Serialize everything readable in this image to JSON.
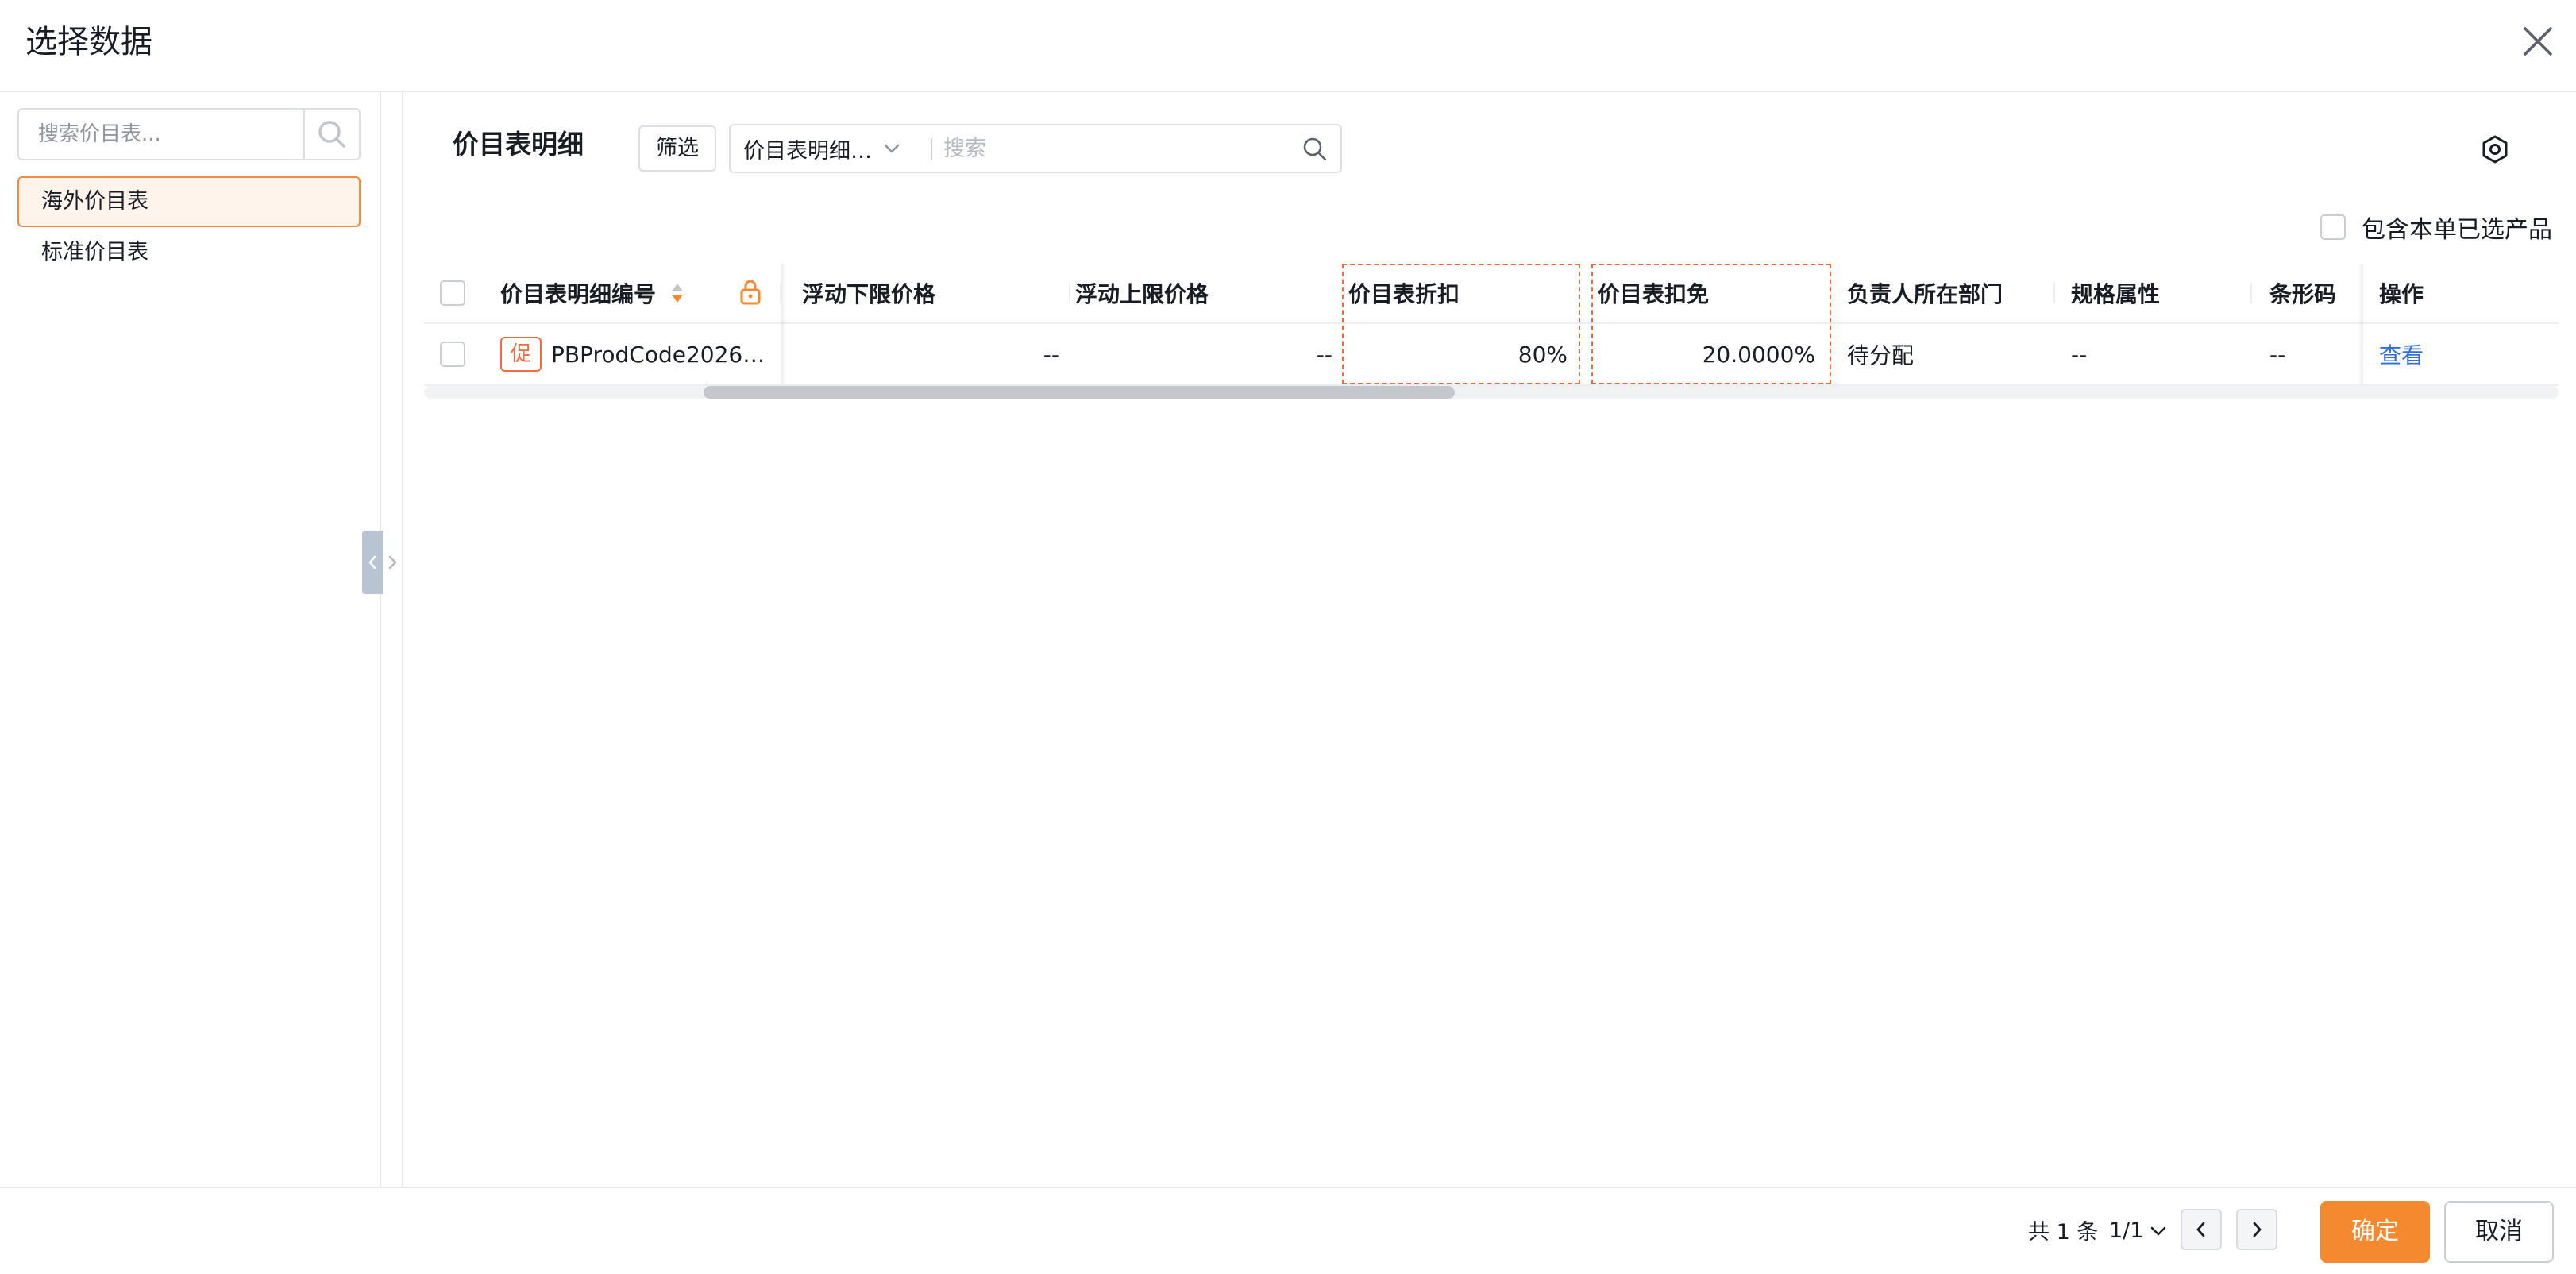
{
  "dialog": {
    "title": "选择数据"
  },
  "sidebar": {
    "search_placeholder": "搜索价目表...",
    "items": [
      {
        "label": "海外价目表",
        "active": true
      },
      {
        "label": "标准价目表",
        "active": false
      }
    ]
  },
  "main": {
    "title": "价目表明细",
    "filter_label": "筛选",
    "field_select": "价目表明细…",
    "search_placeholder": "搜索",
    "include_selected_label": "包含本单已选产品"
  },
  "table": {
    "columns": [
      "价目表明细编号",
      "浮动下限价格",
      "浮动上限价格",
      "价目表折扣",
      "价目表扣免",
      "负责人所在部门",
      "规格属性",
      "条形码",
      "操作"
    ],
    "rows": [
      {
        "badge": "促",
        "code": "PBProdCode2026…",
        "float_low": "--",
        "float_high": "--",
        "discount": "80%",
        "deduction": "20.0000%",
        "department": "待分配",
        "spec": "--",
        "barcode": "--",
        "action": "查看"
      }
    ]
  },
  "footer": {
    "total": "共 1 条",
    "page": "1/1",
    "confirm_label": "确定",
    "cancel_label": "取消"
  },
  "colors": {
    "accent": "#f5892f",
    "highlight_border": "#f06a3c",
    "link": "#2d6fe0",
    "selected_bg": "#fff4ec"
  }
}
